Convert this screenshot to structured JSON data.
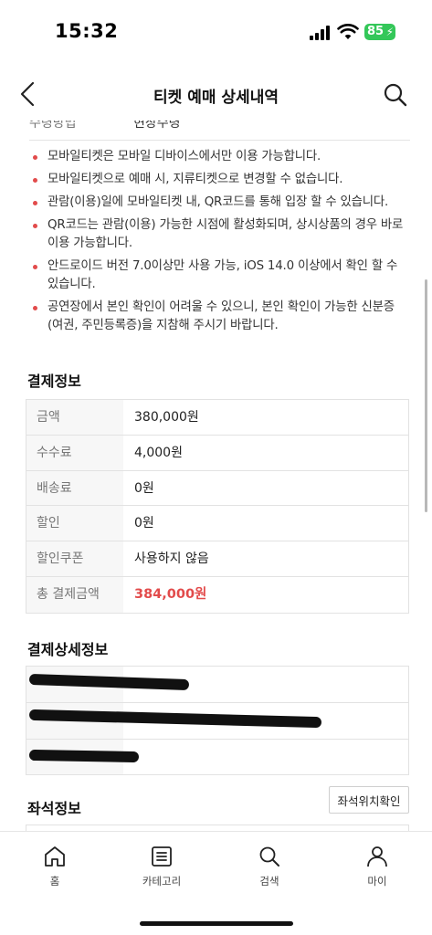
{
  "status_bar": {
    "time": "15:32",
    "battery": "85",
    "icons": [
      "signal-icon",
      "wifi-icon",
      "battery-charging-icon"
    ]
  },
  "header": {
    "title": "티켓 예매 상세내역",
    "icons": [
      "back-chevron-icon",
      "search-icon"
    ]
  },
  "partial_row": {
    "label": "수령방법",
    "value": "현장수령"
  },
  "notes": [
    "모바일티켓은 모바일 디바이스에서만 이용 가능합니다.",
    "모바일티켓으로 예매 시, 지류티켓으로 변경할 수 없습니다.",
    "관람(이용)일에 모바일티켓 내, QR코드를 통해 입장 할 수 있습니다.",
    "QR코드는 관람(이용) 가능한 시점에 활성화되며, 상시상품의 경우 바로 이용 가능합니다.",
    "안드로이드 버전 7.0이상만 사용 가능, iOS 14.0 이상에서 확인 할 수 있습니다.",
    "공연장에서 본인 확인이 어려울 수 있으니, 본인 확인이 가능한 신분증(여권, 주민등록증)을 지참해 주시기 바랍니다."
  ],
  "payment_info": {
    "title": "결제정보",
    "rows": [
      {
        "label": "금액",
        "value": "380,000원"
      },
      {
        "label": "수수료",
        "value": "4,000원"
      },
      {
        "label": "배송료",
        "value": "0원"
      },
      {
        "label": "할인",
        "value": "0원"
      },
      {
        "label": "할인쿠폰",
        "value": "사용하지 않음"
      },
      {
        "label": "총 결제금액",
        "value": "384,000원"
      }
    ],
    "total_color": "#e24b4b"
  },
  "payment_detail": {
    "title": "결제상세정보"
  },
  "seat_info": {
    "title": "좌석정보",
    "button_label": "좌석위치확인"
  },
  "tab_bar": {
    "tabs": [
      {
        "label": "홈",
        "icon": "home-icon"
      },
      {
        "label": "카테고리",
        "icon": "list-icon"
      },
      {
        "label": "검색",
        "icon": "search-icon"
      },
      {
        "label": "마이",
        "icon": "user-icon"
      }
    ]
  },
  "colors": {
    "accent": "#e24b4b",
    "battery": "#34c759"
  }
}
